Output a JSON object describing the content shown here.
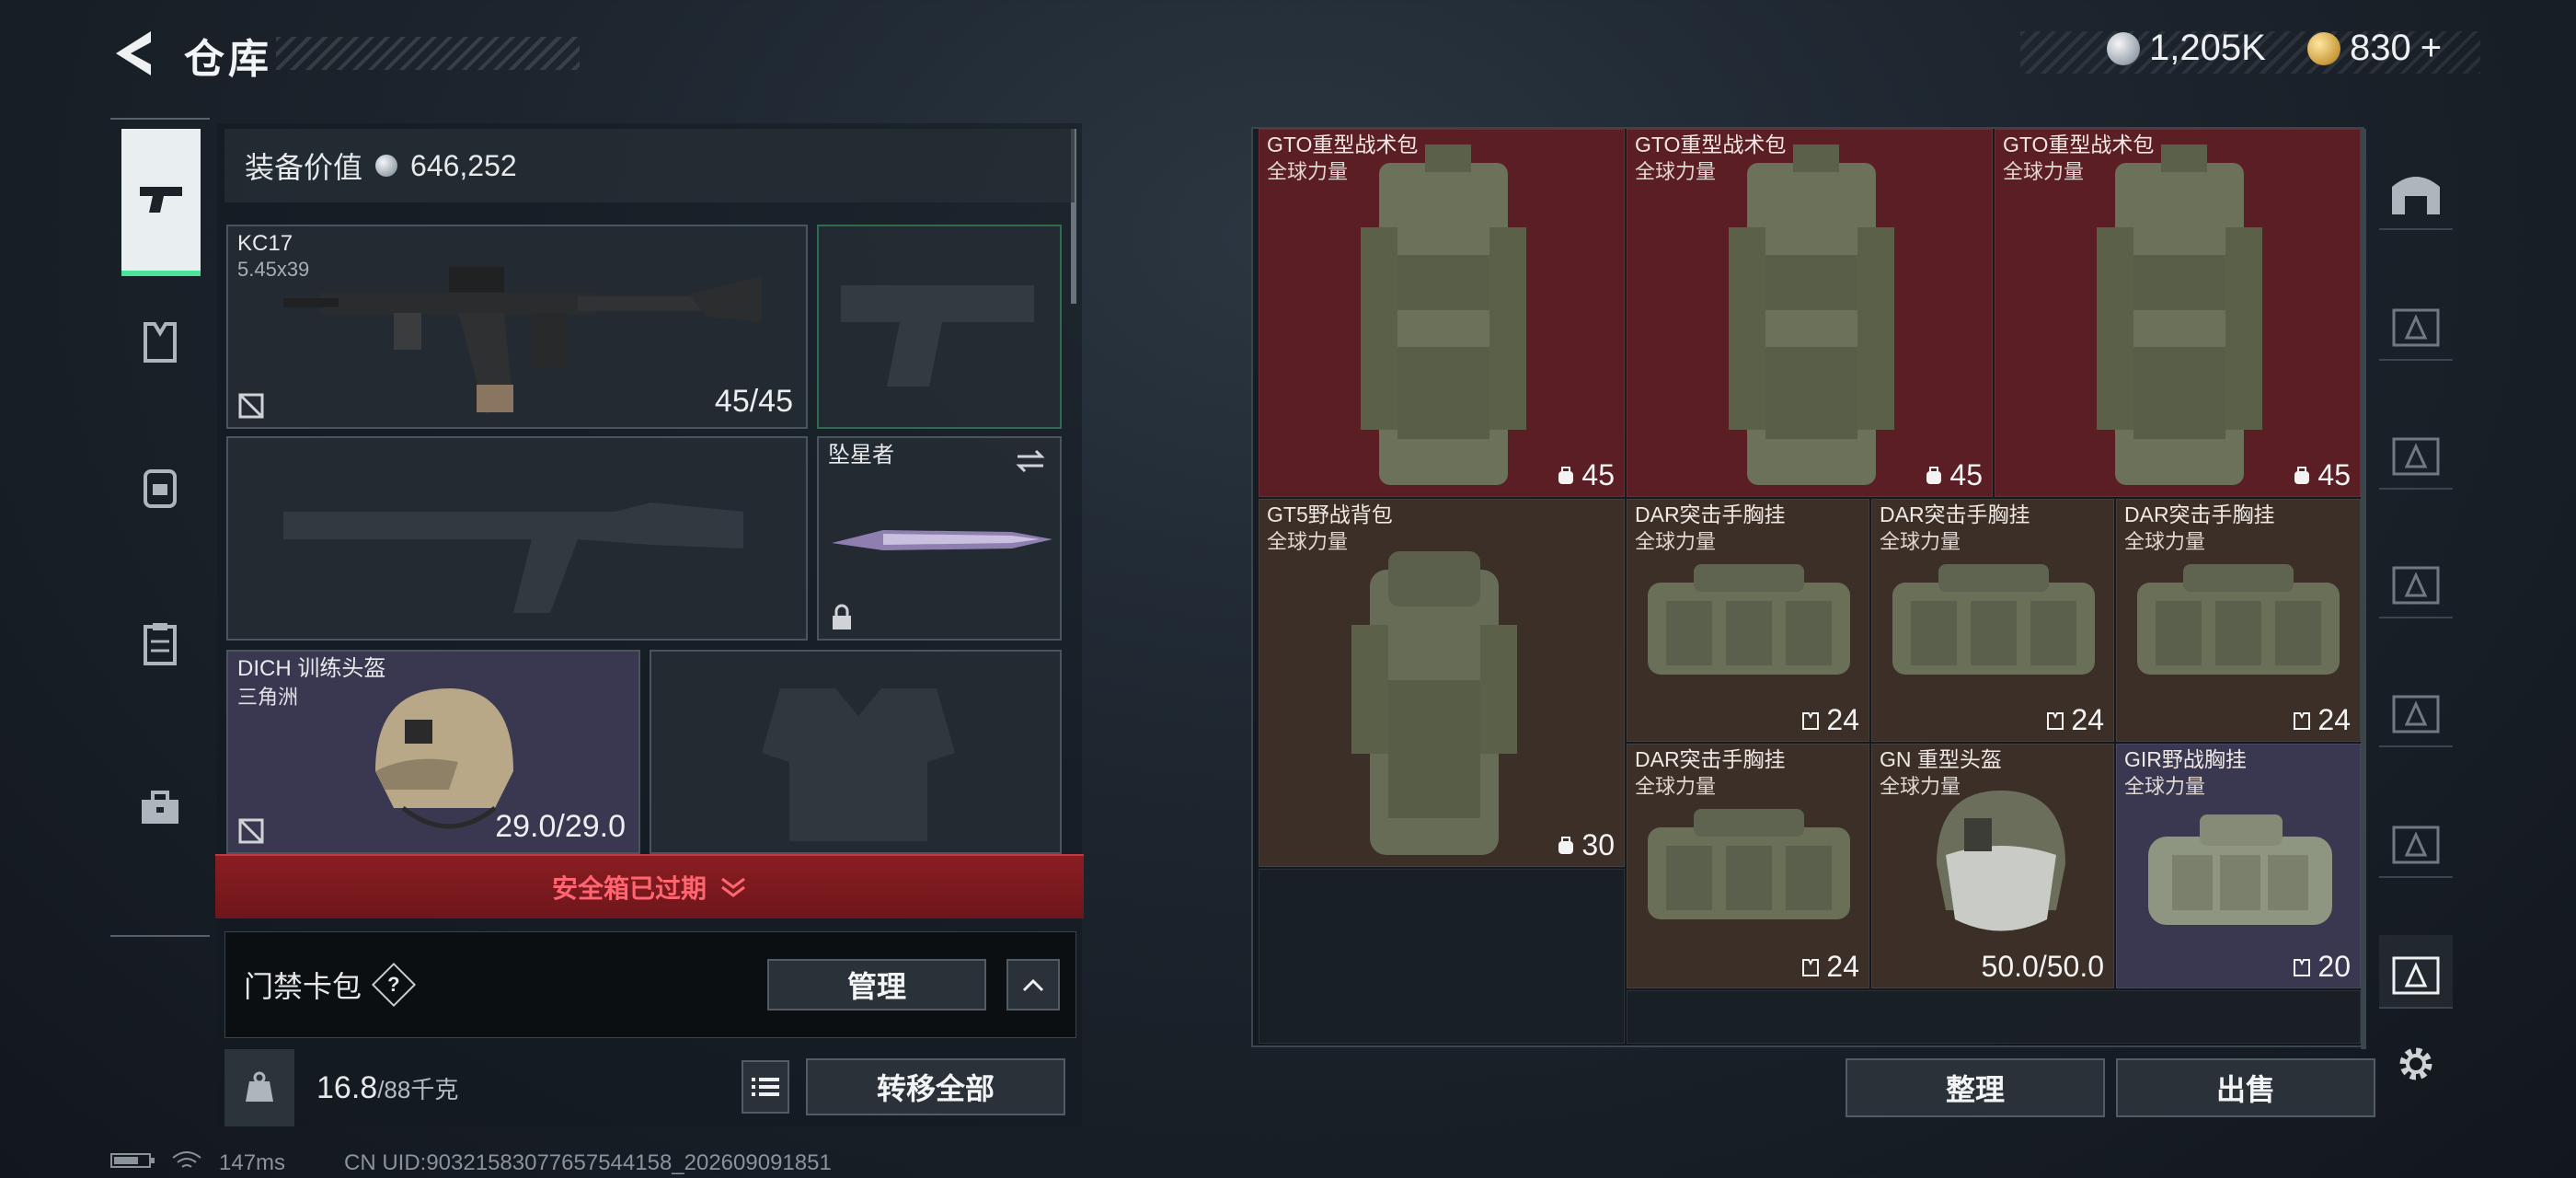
{
  "header": {
    "title": "仓库",
    "currency_silver": "1,205K",
    "currency_gold": "830",
    "currency_plus": "+"
  },
  "equipment": {
    "value_label": "装备价值",
    "value": "646,252",
    "primary_weapon": {
      "name": "KC17",
      "caliber": "5.45x39",
      "ammo": "45/45"
    },
    "melee": {
      "name": "坠星者"
    },
    "helmet": {
      "name": "DICH 训练头盔",
      "faction": "三角洲",
      "durability": "29.0/29.0"
    }
  },
  "safebox": {
    "label": "安全箱已过期"
  },
  "access_card": {
    "label": "门禁卡包",
    "help": "?",
    "manage_button": "管理"
  },
  "weight": {
    "current": "16.8",
    "max": "/88千克",
    "transfer_all_button": "转移全部"
  },
  "storage": {
    "items": [
      {
        "name": "GTO重型战术包",
        "owner": "全球力量",
        "value": "45"
      },
      {
        "name": "GTO重型战术包",
        "owner": "全球力量",
        "value": "45"
      },
      {
        "name": "GTO重型战术包",
        "owner": "全球力量",
        "value": "45"
      },
      {
        "name": "GT5野战背包",
        "owner": "全球力量",
        "value": "30"
      },
      {
        "name": "DAR突击手胸挂",
        "owner": "全球力量",
        "value": "24"
      },
      {
        "name": "DAR突击手胸挂",
        "owner": "全球力量",
        "value": "24"
      },
      {
        "name": "DAR突击手胸挂",
        "owner": "全球力量",
        "value": "24"
      },
      {
        "name": "DAR突击手胸挂",
        "owner": "全球力量",
        "value": "24"
      },
      {
        "name": "GN 重型头盔",
        "owner": "全球力量",
        "value": "50.0/50.0"
      },
      {
        "name": "GIR野战胸挂",
        "owner": "全球力量",
        "value": "20"
      }
    ],
    "sort_button": "整理",
    "sell_button": "出售"
  },
  "status": {
    "ping": "147ms",
    "uid": "CN UID:9032158307765​7544158_202609091851"
  },
  "colors": {
    "accent_green": "#4be29a",
    "alert_red": "#ff6670"
  }
}
